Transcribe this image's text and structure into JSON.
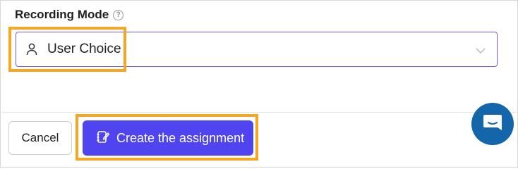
{
  "form": {
    "recording_mode_label": "Recording Mode",
    "help_icon": "help-circle-icon",
    "recording_mode_select": {
      "selected_value": "User Choice",
      "leading_icon": "user-icon",
      "trailing_icon": "chevron-down-icon"
    }
  },
  "footer": {
    "cancel_label": "Cancel",
    "create_label": "Create the assignment",
    "create_icon": "edit-notebook-icon"
  },
  "chat_widget": {
    "icon": "chat-icon"
  },
  "colors": {
    "primary_button": "#4f44f0",
    "select_border": "#6b5cf6",
    "highlight_annotation": "#f5a623",
    "chat_launcher": "#1466ab"
  }
}
